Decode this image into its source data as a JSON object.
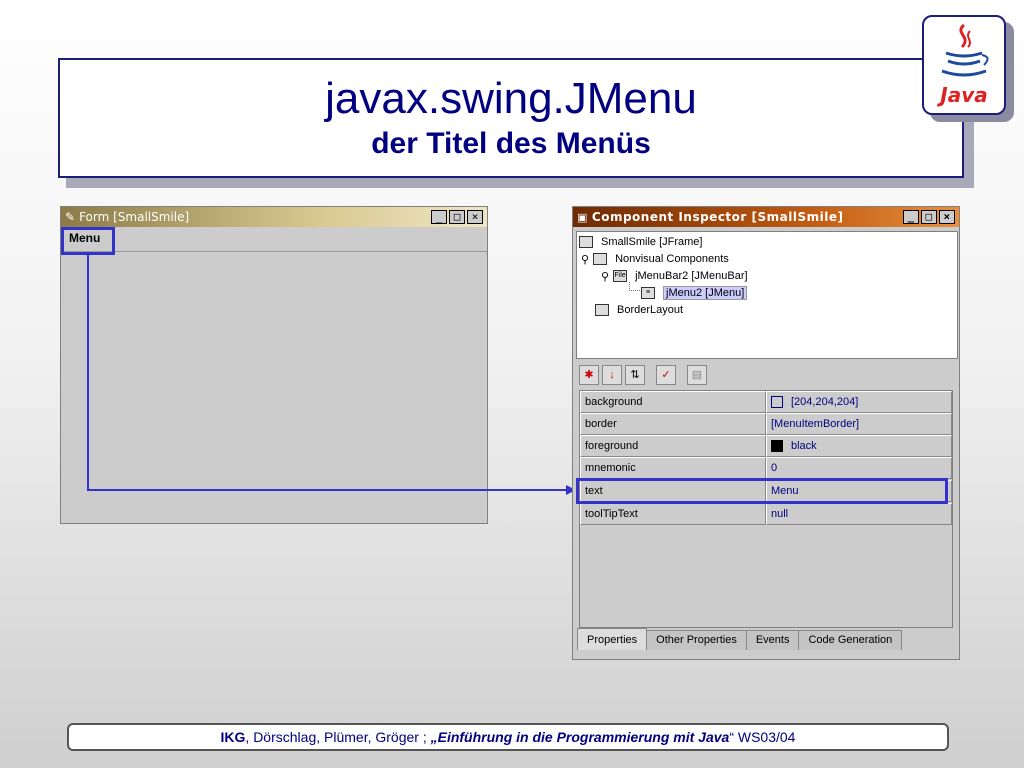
{
  "slide": {
    "title": "javax.swing.JMenu",
    "subtitle": "der Titel des Menüs",
    "logo_text": "Java",
    "footer": {
      "org": "IKG",
      "authors": ", Dörschlag, Plümer, Gröger ; ",
      "course": "Einführung in die Programmierung mit Java",
      "term": "“ WS03/04"
    }
  },
  "form_window": {
    "title": "Form [SmallSmile]",
    "menu_label": "Menu"
  },
  "inspector": {
    "title": "Component Inspector [SmallSmile]",
    "tree": [
      "SmallSmile [JFrame]",
      "Nonvisual Components",
      "jMenuBar2 [JMenuBar]",
      "jMenu2 [JMenu]",
      "BorderLayout"
    ],
    "properties": [
      {
        "name": "background",
        "value": "[204,204,204]"
      },
      {
        "name": "border",
        "value": "[MenuItemBorder]"
      },
      {
        "name": "foreground",
        "value": "black"
      },
      {
        "name": "mnemonic",
        "value": "0"
      },
      {
        "name": "text",
        "value": "Menu"
      },
      {
        "name": "toolTipText",
        "value": "null"
      }
    ],
    "tabs": [
      "Properties",
      "Other Properties",
      "Events",
      "Code Generation"
    ]
  },
  "colors": {
    "accent": "#3333cc",
    "title_text": "#000080",
    "form_titlebar": "#8c7b48",
    "inspector_titlebar": "#c05a10"
  }
}
